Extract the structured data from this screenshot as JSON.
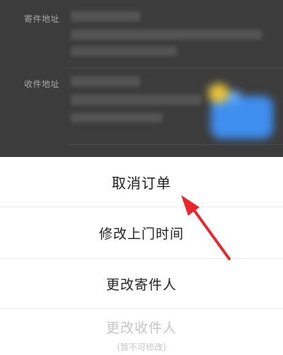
{
  "background_form": {
    "sender_address_label": "寄件地址",
    "receiver_address_label": "收件地址"
  },
  "action_sheet": {
    "cancel_order": "取消订单",
    "modify_pickup_time": "修改上门时间",
    "change_sender": "更改寄件人",
    "change_receiver": "更改收件人",
    "change_receiver_note": "(暂不可修改)"
  },
  "annotation": {
    "arrow_color": "#e8262c"
  }
}
